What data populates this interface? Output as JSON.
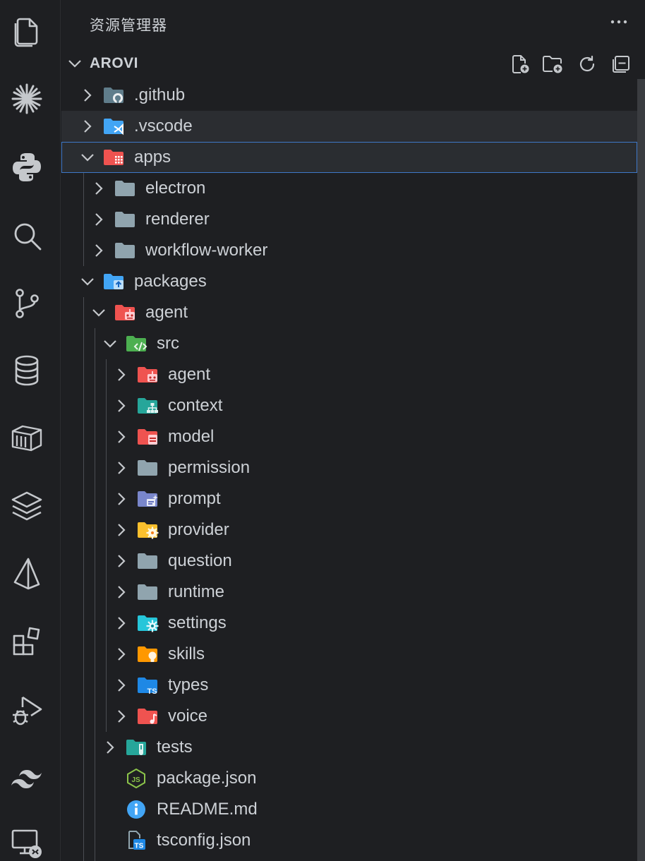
{
  "explorer": {
    "title": "资源管理器",
    "section_title": "AROVI",
    "actions": [
      "new-file-icon",
      "new-folder-icon",
      "refresh-icon",
      "collapse-all-icon"
    ]
  },
  "activity_bar": {
    "items": [
      "explorer-icon",
      "claude-icon",
      "python-icon",
      "search-icon",
      "source-control-icon",
      "database-icon",
      "container-icon",
      "layers-icon",
      "prisma-icon",
      "extensions-icon",
      "run-debug-icon",
      "tailwind-icon",
      "remote-explorer-icon"
    ]
  },
  "tree": [
    {
      "label": ".github",
      "icon": "folder-github-icon",
      "expanded": false
    },
    {
      "label": ".vscode",
      "icon": "folder-vscode-icon",
      "expanded": false
    },
    {
      "label": "apps",
      "icon": "folder-apps-icon",
      "expanded": true,
      "selected": true
    },
    {
      "label": "electron",
      "icon": "folder-icon",
      "expanded": false
    },
    {
      "label": "renderer",
      "icon": "folder-icon",
      "expanded": false
    },
    {
      "label": "workflow-worker",
      "icon": "folder-icon",
      "expanded": false
    },
    {
      "label": "packages",
      "icon": "folder-packages-icon",
      "expanded": true
    },
    {
      "label": "agent",
      "icon": "folder-robot-icon",
      "expanded": true
    },
    {
      "label": "src",
      "icon": "folder-src-icon",
      "expanded": true
    },
    {
      "label": "agent",
      "icon": "folder-robot-icon",
      "expanded": false
    },
    {
      "label": "context",
      "icon": "folder-context-icon",
      "expanded": false
    },
    {
      "label": "model",
      "icon": "folder-model-icon",
      "expanded": false
    },
    {
      "label": "permission",
      "icon": "folder-icon",
      "expanded": false
    },
    {
      "label": "prompt",
      "icon": "folder-prompt-icon",
      "expanded": false
    },
    {
      "label": "provider",
      "icon": "folder-provider-icon",
      "expanded": false
    },
    {
      "label": "question",
      "icon": "folder-icon",
      "expanded": false
    },
    {
      "label": "runtime",
      "icon": "folder-icon",
      "expanded": false
    },
    {
      "label": "settings",
      "icon": "folder-settings-icon",
      "expanded": false
    },
    {
      "label": "skills",
      "icon": "folder-skills-icon",
      "expanded": false
    },
    {
      "label": "types",
      "icon": "folder-types-icon",
      "expanded": false
    },
    {
      "label": "voice",
      "icon": "folder-voice-icon",
      "expanded": false
    },
    {
      "label": "tests",
      "icon": "folder-tests-icon",
      "expanded": false
    },
    {
      "label": "package.json",
      "icon": "nodejs-file-icon"
    },
    {
      "label": "README.md",
      "icon": "info-file-icon"
    },
    {
      "label": "tsconfig.json",
      "icon": "tsconfig-file-icon"
    }
  ],
  "colors": {
    "background": "#1e1f22",
    "text": "#cdd1d6",
    "selection_border": "#3e78c8",
    "folder_gray": "#90a4ae",
    "folder_red": "#ef5350",
    "folder_blue": "#42a5f5",
    "folder_green": "#4caf50",
    "folder_teal": "#26a69a",
    "folder_yellow": "#fbc02d",
    "folder_orange": "#ff9800",
    "folder_purple": "#7986cb",
    "folder_cyan": "#26c6da"
  }
}
